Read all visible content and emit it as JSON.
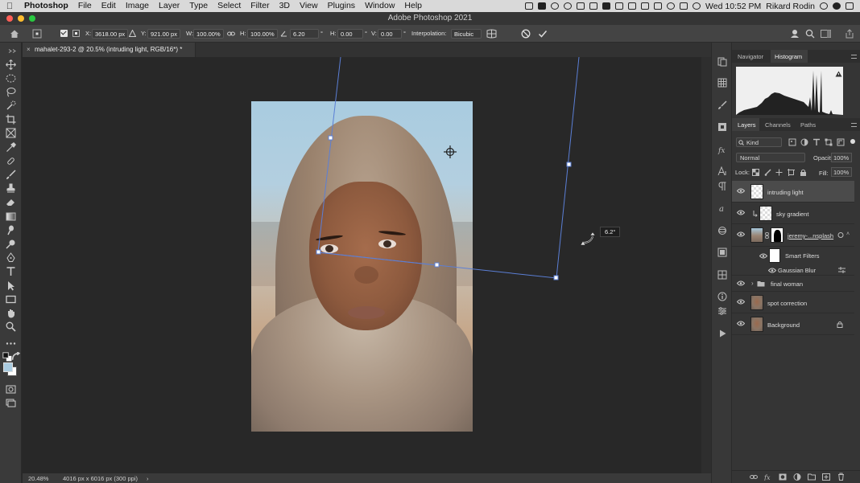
{
  "menubar": {
    "app": "Photoshop",
    "items": [
      "File",
      "Edit",
      "Image",
      "Layer",
      "Type",
      "Select",
      "Filter",
      "3D",
      "View",
      "Plugins",
      "Window",
      "Help"
    ],
    "clock": "Wed 10:52 PM",
    "user": "Rikard Rodin"
  },
  "window": {
    "title": "Adobe Photoshop 2021",
    "traffic_colors": [
      "#ff5f57",
      "#febc2e",
      "#28c840"
    ]
  },
  "options": {
    "x_label": "X:",
    "x_value": "3618.00 px",
    "y_label": "Y:",
    "y_value": "921.00 px",
    "w_label": "W:",
    "w_value": "100.00%",
    "h_label": "H:",
    "h_value": "100.00%",
    "angle_value": "6.20",
    "degree": "°",
    "hskew_label": "H:",
    "hskew_value": "0.00",
    "vskew_label": "V:",
    "vskew_value": "0.00",
    "interp_label": "Interpolation:",
    "interp_value": "Bicubic"
  },
  "document": {
    "tab_title": "mahalet-293-2 @ 20.5% (intruding light, RGB/16*) *",
    "close": "×",
    "angle_tooltip": "6.2°"
  },
  "status": {
    "zoom": "20.48%",
    "size": "4016 px x 6016 px (300 ppi)",
    "arrow": "›"
  },
  "panels": {
    "top_tabs": [
      "Navigator",
      "Histogram"
    ],
    "layer_tabs": [
      "Layers",
      "Channels",
      "Paths"
    ],
    "filter_kind": "Kind",
    "blend_mode": "Normal",
    "opacity_label": "Opacity:",
    "opacity_value": "100%",
    "lock_label": "Lock:",
    "fill_label": "Fill:",
    "fill_value": "100%"
  },
  "layers": [
    {
      "name": "intruding light"
    },
    {
      "name": "sky gradient"
    },
    {
      "name": "jeremy-...nsplash"
    },
    {
      "name": "Smart Filters"
    },
    {
      "name": "Gaussian Blur"
    },
    {
      "name": "final woman"
    },
    {
      "name": "spot correction"
    },
    {
      "name": "Background"
    }
  ],
  "colors": {
    "accent_handle": "#5b7fd6",
    "selection": "#4b4b4b"
  }
}
